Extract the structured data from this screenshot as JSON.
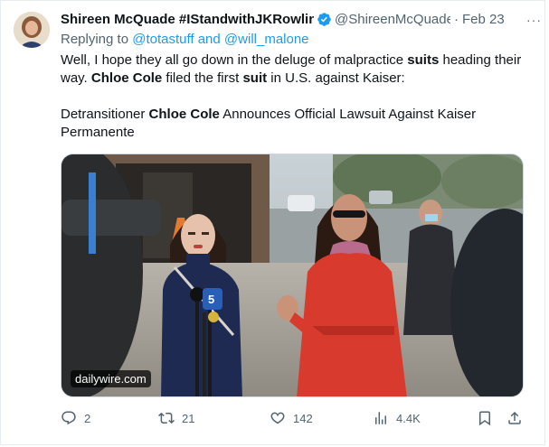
{
  "tweet": {
    "author_name": "Shireen McQuade #IStandwithJKRowling",
    "author_handle": "@ShireenMcQuade",
    "separator": "·",
    "date": "Feb 23",
    "more": "···",
    "replying_prefix": "Replying to",
    "reply_handle_1": "@totastuff",
    "reply_and": "and",
    "reply_handle_2": "@will_malone",
    "text": {
      "p1_a": "Well, I hope they all go down in the deluge of malpractice ",
      "p1_b": "suits",
      "p1_c": " heading their way.  ",
      "p1_d": "Chloe Cole",
      "p1_e": " filed the first ",
      "p1_f": "suit",
      "p1_g": " in U.S. against Kaiser:",
      "p2_a": "Detransitioner ",
      "p2_b": "Chloe Cole",
      "p2_c": " Announces Official Lawsuit Against Kaiser Permanente"
    },
    "media": {
      "watermark": "dailywire.com",
      "mic_label": "5"
    }
  },
  "actions": {
    "replies": "2",
    "retweets": "21",
    "likes": "142",
    "views": "4.4K"
  },
  "icons": {
    "verified": "verified-badge-icon",
    "reply": "reply-icon",
    "retweet": "retweet-icon",
    "like": "heart-icon",
    "views": "views-icon",
    "bookmark": "bookmark-icon",
    "share": "share-icon"
  },
  "colors": {
    "link": "#1d9bf0",
    "muted": "#536471",
    "text": "#0f1419",
    "coat": "#d93a2e"
  }
}
